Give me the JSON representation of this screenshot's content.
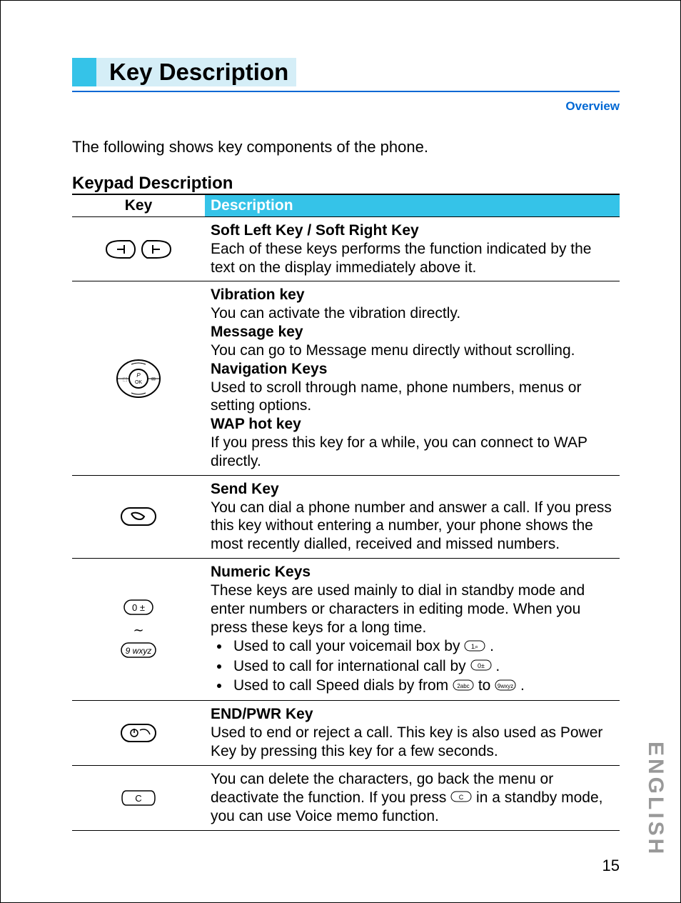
{
  "title": "Key Description",
  "overview_label": "Overview",
  "intro": "The following shows key components of the phone.",
  "section_heading": "Keypad Description",
  "table": {
    "header_key": "Key",
    "header_desc": "Description"
  },
  "rows": [
    {
      "items": [
        {
          "heading": "Soft Left Key / Soft Right Key",
          "text": "Each of these keys performs the function indicated by the text on the display immediately above it."
        }
      ]
    },
    {
      "items": [
        {
          "heading": "Vibration key",
          "text": "You can activate the vibration directly."
        },
        {
          "heading": "Message key",
          "text": "You can go to Message menu directly without scrolling."
        },
        {
          "heading": "Navigation Keys",
          "text": "Used to scroll through name, phone numbers, menus or setting options."
        },
        {
          "heading": "WAP hot key",
          "text": "If you press this key for a while, you can connect to WAP directly."
        }
      ]
    },
    {
      "items": [
        {
          "heading": "Send Key",
          "text": "You can dial a phone number and answer a call. If you press this key without entering a number, your phone shows the most recently dialled, received and missed numbers."
        }
      ]
    },
    {
      "heading": "Numeric Keys",
      "text": "These keys are used mainly to dial in standby mode and enter numbers or characters in editing mode. When you press these keys for a long time.",
      "bullets": [
        {
          "pre": "Used to call your voicemail box by ",
          "post": " ."
        },
        {
          "pre": "Used to call for international call by ",
          "post": " ."
        },
        {
          "pre": "Used to call Speed dials by from ",
          "mid": " to ",
          "post": " ."
        }
      ]
    },
    {
      "items": [
        {
          "heading": "END/PWR Key",
          "text": "Used to end or reject a call. This key is also used as Power Key by pressing this key for a few seconds."
        }
      ]
    },
    {
      "text_pre": "You can delete the characters, go back the menu or deactivate the function. If you press ",
      "text_post": " in a standby mode, you can use Voice memo function."
    }
  ],
  "side_label": "ENGLISH",
  "page_number": "15"
}
